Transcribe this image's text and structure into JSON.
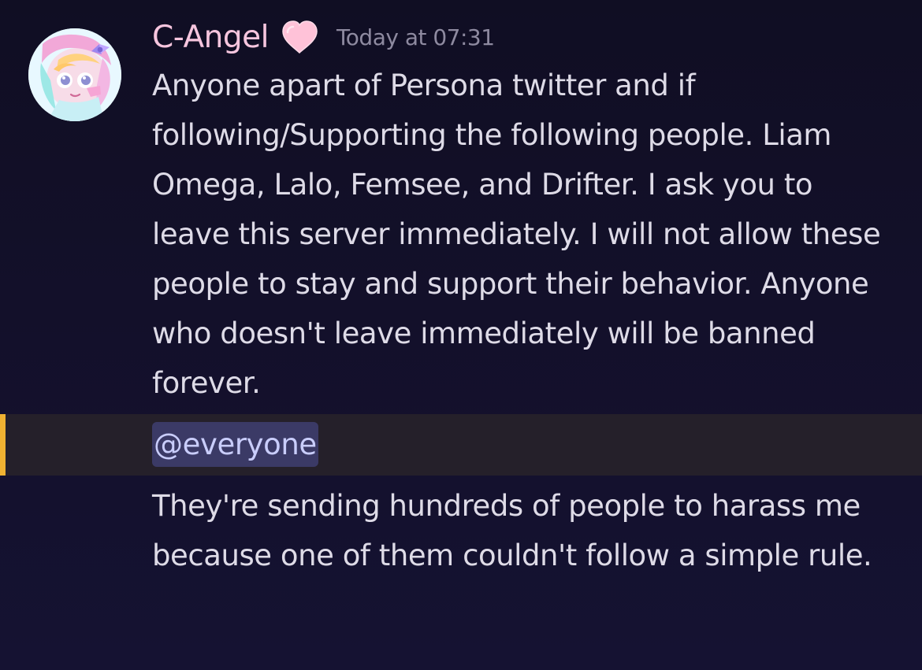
{
  "message": {
    "author": {
      "name": "C-Angel",
      "avatar_icon": "anime-girl-avatar",
      "badge_icon": "pink-heart-icon",
      "name_color": "#f6c5de"
    },
    "timestamp": "Today at 07:31",
    "content": "Anyone apart of Persona twitter and if following/Supporting the following people. Liam Omega, Lalo, Femsee, and Drifter. I ask you to leave this server immediately. I will not allow these people to stay and support their behavior. Anyone who doesn't leave immediately will be banned forever.",
    "mention": {
      "text": "@everyone",
      "highlight_color": "#f0b232",
      "pill_color": "#3b3a66"
    },
    "followup": "They're sending hundreds of people to harass me because one of them couldn't follow a simple rule."
  }
}
